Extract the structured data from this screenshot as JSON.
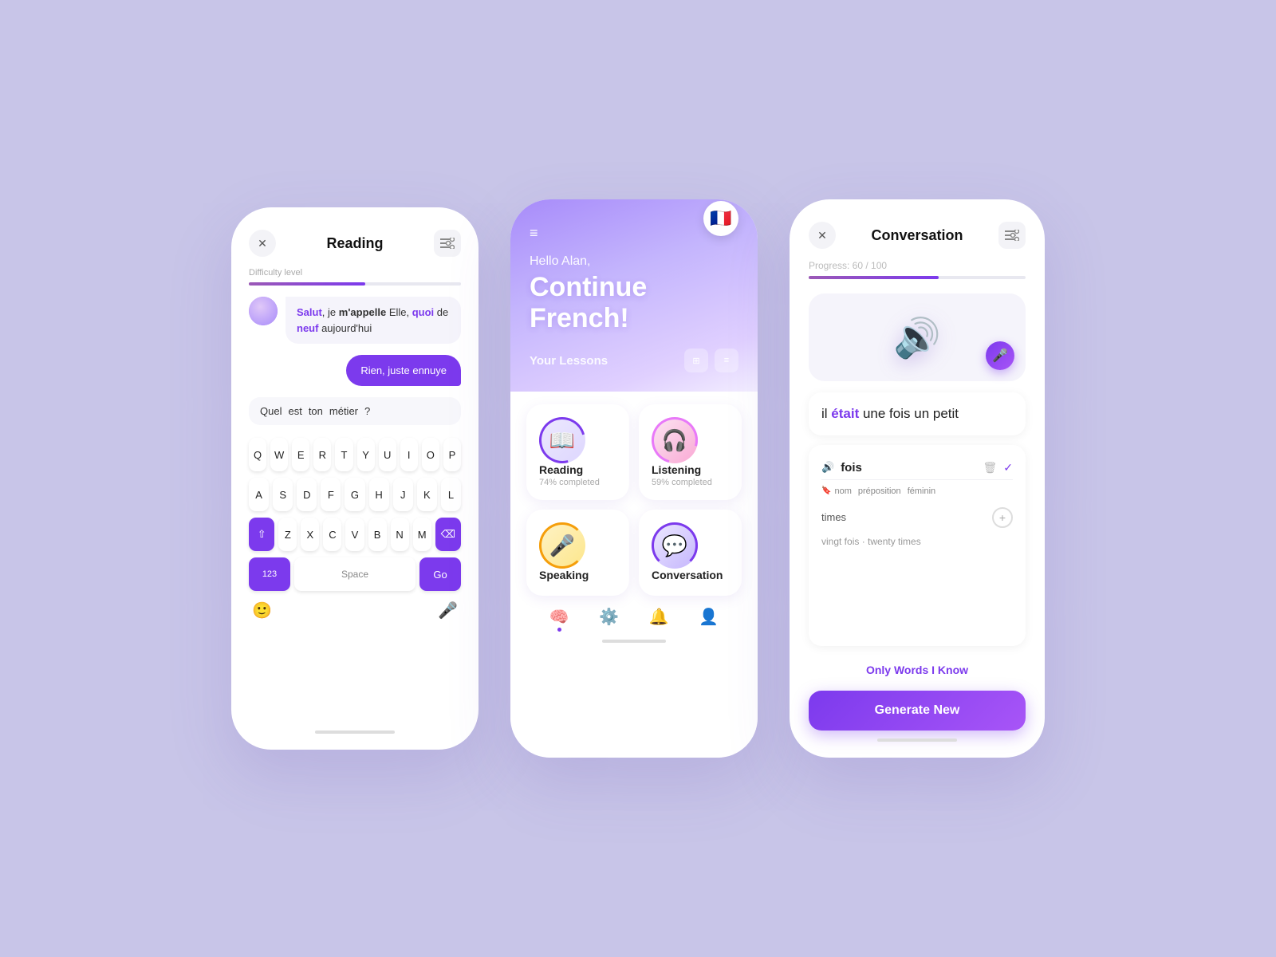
{
  "background": "#c8c5e8",
  "screen1": {
    "title": "Reading",
    "difficulty_label": "Difficulty level",
    "difficulty_progress": 55,
    "bubble_text": "Salut, je m'appelle Elle, quoi de neuf aujourd'hui",
    "bubble_highlight_words": [
      "Salut",
      "quoi",
      "neuf"
    ],
    "reply_text": "Rien, juste ennuye",
    "question_words": [
      "Quel",
      "est",
      "ton",
      "métier",
      "?"
    ],
    "keyboard_rows": [
      [
        "Q",
        "W",
        "E",
        "R",
        "T",
        "Y",
        "U",
        "I",
        "O",
        "P"
      ],
      [
        "A",
        "S",
        "D",
        "F",
        "G",
        "H",
        "J",
        "K",
        "L"
      ],
      [
        "Z",
        "X",
        "C",
        "V",
        "B",
        "N",
        "M"
      ]
    ],
    "key_special_label": "123",
    "key_space_label": "Space",
    "key_go_label": "Go"
  },
  "screen2": {
    "greeting": "Hello Alan,",
    "cta_line1": "Continue",
    "cta_line2": "French!",
    "flag_emoji": "🇫🇷",
    "lessons_title": "Your Lessons",
    "lessons": [
      {
        "name": "Reading",
        "progress": "74% completed",
        "icon": "📖",
        "ring": "reading"
      },
      {
        "name": "Listening",
        "progress": "59% completed",
        "icon": "🎧",
        "ring": "listening"
      },
      {
        "name": "Speaking",
        "progress": "",
        "icon": "🎤",
        "ring": "speaking"
      },
      {
        "name": "Conversation",
        "progress": "",
        "icon": "💬",
        "ring": "conversation"
      }
    ],
    "nav_items": [
      "🧠",
      "⚙️",
      "🔔",
      "👤"
    ]
  },
  "screen3": {
    "title": "Conversation",
    "progress_label": "Progress: 60 / 100",
    "progress_value": 60,
    "sentence": "il était une fois un petit",
    "accent_word": "était",
    "word": "fois",
    "tags": [
      "nom",
      "préposition",
      "féminin"
    ],
    "translation": "times",
    "example": "vingt fois · twenty times",
    "only_words_label": "Only Words I Know",
    "generate_label": "Generate New"
  }
}
